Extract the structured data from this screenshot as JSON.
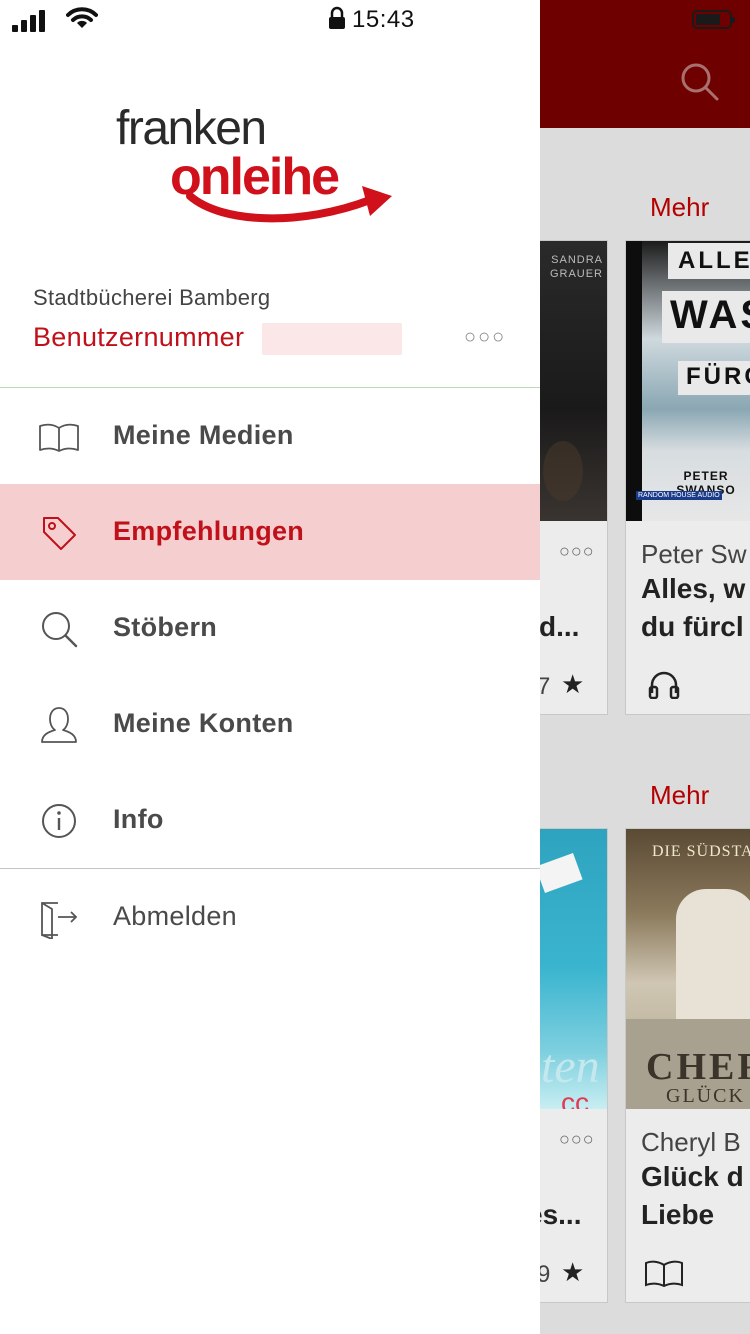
{
  "status_bar": {
    "time": "15:43"
  },
  "drawer": {
    "logo": {
      "line1": "franken",
      "line2": "onleihe"
    },
    "library_name": "Stadtbücherei Bamberg",
    "user_label": "Benutzernummer",
    "more_icon": "more-dots-icon",
    "menu": [
      {
        "label": "Meine Medien",
        "icon": "book-icon",
        "active": false
      },
      {
        "label": "Empfehlungen",
        "icon": "tag-icon",
        "active": true
      },
      {
        "label": "Stöbern",
        "icon": "search-icon",
        "active": false
      },
      {
        "label": "Meine Konten",
        "icon": "user-icon",
        "active": false
      },
      {
        "label": "Info",
        "icon": "info-icon",
        "active": false
      }
    ],
    "logout": {
      "label": "Abmelden",
      "icon": "logout-icon"
    }
  },
  "background": {
    "mehr_label": "Mehr",
    "cards": [
      {
        "cover_lines": [
          "SANDRA",
          "GRAUER"
        ],
        "title_tail": "d...",
        "rating_tail": "7"
      },
      {
        "cover_lines": [
          "ALLES",
          "WAS",
          "FÜRC",
          "PETER",
          "SWANSO",
          "RANDOM HOUSE AUDIO"
        ],
        "author": "Peter Sw",
        "title_line1": "Alles, w",
        "title_line2": "du fürcl"
      },
      {
        "title_tail": "es...",
        "rating_tail": "9"
      },
      {
        "cover_lines": [
          "DIE SÜDSTA",
          "CHERY",
          "GLÜCK"
        ],
        "author": "Cheryl B",
        "title_line1": "Glück d",
        "title_line2": "Liebe"
      }
    ]
  },
  "colors": {
    "accent": "#c0111a",
    "active_bg": "#f5cfd0",
    "header_dim": "#6f0000"
  }
}
